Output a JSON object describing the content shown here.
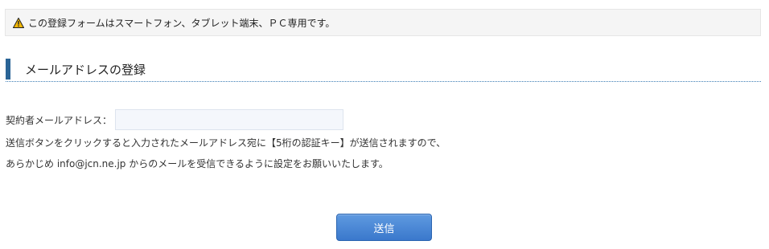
{
  "notice": {
    "icon": "warning-icon",
    "text": "この登録フォームはスマートフォン、タブレット端末、ＰＣ専用です。"
  },
  "section": {
    "title": "メールアドレスの登録"
  },
  "form": {
    "email_label": "契約者メールアドレス：",
    "email_value": "",
    "email_placeholder": ""
  },
  "description": {
    "line1": "送信ボタンをクリックすると入力されたメールアドレス宛に【5桁の認証キー】が送信されますので、",
    "line2": "あらかじめ info@jcn.ne.jp からのメールを受信できるように設定をお願いいたします。"
  },
  "submit": {
    "label": "送信"
  },
  "colors": {
    "accent": "#2a6496",
    "button": "#3a78cc",
    "notice_bg": "#f5f5f5"
  }
}
